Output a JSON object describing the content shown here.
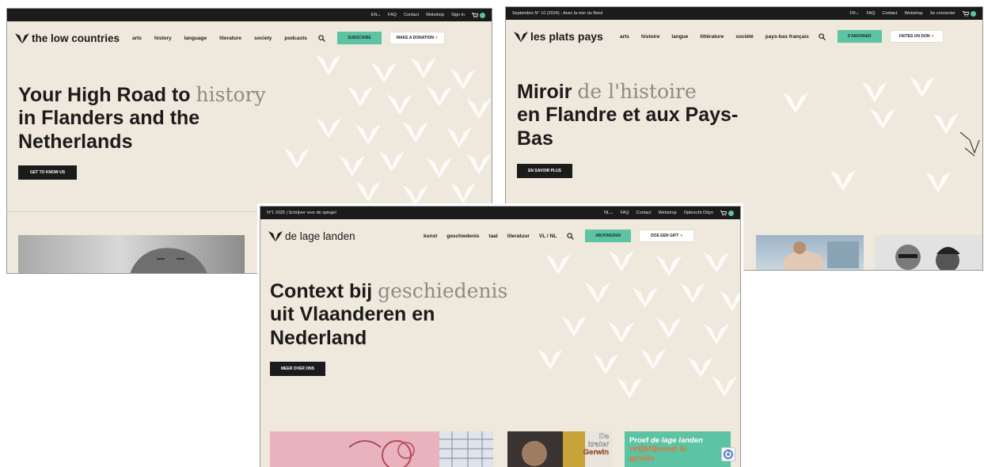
{
  "windows": {
    "en": {
      "topbar": {
        "issue": "",
        "lang": "EN",
        "faq": "FAQ",
        "contact": "Contact",
        "webshop": "Webshop",
        "account": "Sign in"
      },
      "logo": "the low countries",
      "menu": [
        "arts",
        "history",
        "language",
        "literature",
        "society",
        "podcasts"
      ],
      "subscribe": "SUBSCRIBE",
      "donate": "MAKE A DONATION",
      "hero": {
        "line1": "Your High Road to",
        "accent": "history",
        "line2": "in Flanders and the",
        "line3": "Netherlands"
      },
      "cta": "GET TO KNOW US"
    },
    "fr": {
      "topbar": {
        "issue": "Septembre N° 10 (2024) - Avec la mer du Nord",
        "lang": "FR",
        "faq": "FAQ",
        "contact": "Contact",
        "webshop": "Webshop",
        "account": "Se connecter"
      },
      "logo": "les plats pays",
      "menu": [
        "arts",
        "histoire",
        "langue",
        "littérature",
        "société",
        "pays-bas français"
      ],
      "subscribe": "S'ABONNER",
      "donate": "FAITES UN DON",
      "hero": {
        "line1": "Miroir",
        "accent": "de l'histoire",
        "line2": "en Flandre et aux Pays-",
        "line3": "Bas"
      },
      "cta": "EN SAVOIR PLUS"
    },
    "nl": {
      "topbar": {
        "issue": "N°1 2025 | Schrijver voor de spiegel",
        "lang": "NL",
        "faq": "FAQ",
        "contact": "Contact",
        "webshop": "Webshop",
        "account": "Opbrecht Odyn"
      },
      "logo": "de lage landen",
      "menu": [
        "kunst",
        "geschiedenis",
        "taal",
        "literatuur",
        "VL / NL"
      ],
      "subscribe": "ABONNEREN",
      "donate": "DOE EEN GIFT",
      "hero": {
        "line1": "Context bij",
        "accent": "geschiedenis",
        "line2": "uit Vlaanderen en",
        "line3": "Nederland"
      },
      "cta": "MEER OVER ONS",
      "book": {
        "l1": "De",
        "l2": "krater",
        "l3": "Gerwin"
      },
      "promo": {
        "l1": "Proef",
        "l2": "de lage landen",
        "l3": "vrijblijvend &",
        "l4": "gratis"
      }
    }
  },
  "colors": {
    "page_bg": "#efe8dc",
    "topbar": "#1b1b1b",
    "accent_green": "#5cc3a3",
    "heart": "#e8733a",
    "title_accent": "#8f8a84",
    "pattern": "#ffffff"
  },
  "icons": [
    "logo-icon",
    "search-icon",
    "cart-icon",
    "heart-icon",
    "chevron-down-icon",
    "recaptcha-icon"
  ]
}
